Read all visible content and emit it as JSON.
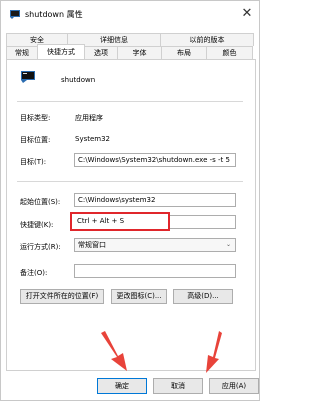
{
  "window": {
    "title": "shutdown 属性",
    "close_glyph": "✕"
  },
  "tabs": {
    "top": [
      "安全",
      "详细信息",
      "以前的版本"
    ],
    "bottom": [
      "常规",
      "快捷方式",
      "选项",
      "字体",
      "布局",
      "颜色"
    ],
    "active": "快捷方式"
  },
  "shortcut": {
    "name": "shutdown",
    "target_type_label": "目标类型:",
    "target_type_value": "应用程序",
    "target_location_label": "目标位置:",
    "target_location_value": "System32",
    "target_label": "目标(T):",
    "target_value": "C:\\Windows\\System32\\shutdown.exe -s -t 5",
    "start_in_label": "起始位置(S):",
    "start_in_value": "C:\\Windows\\system32",
    "hotkey_label": "快捷键(K):",
    "hotkey_value": "Ctrl + Alt + S",
    "run_label": "运行方式(R):",
    "run_value": "常规窗口",
    "comment_label": "备注(O):",
    "comment_value": ""
  },
  "buttons": {
    "open_location": "打开文件所在的位置(F)",
    "change_icon": "更改图标(C)...",
    "advanced": "高级(D)..."
  },
  "footer": {
    "ok": "确定",
    "cancel": "取消",
    "apply": "应用(A)"
  },
  "colors": {
    "highlight_border": "#e0262b",
    "arrow": "#e8433a",
    "primary_border": "#0078d7"
  },
  "icons": {
    "title_icon": "console-shortcut-icon",
    "app_icon": "console-shortcut-icon",
    "close": "close-icon",
    "dropdown": "chevron-down-icon"
  }
}
